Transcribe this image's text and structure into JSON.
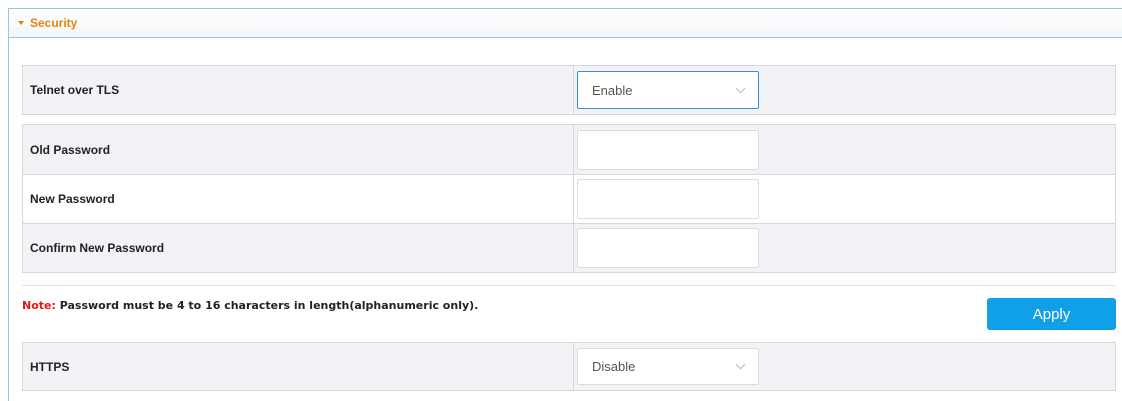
{
  "section": {
    "title": "Security"
  },
  "telnet": {
    "label": "Telnet over TLS",
    "value": "Enable"
  },
  "password": {
    "old_label": "Old Password",
    "new_label": "New Password",
    "confirm_label": "Confirm New Password",
    "old_value": "",
    "new_value": "",
    "confirm_value": ""
  },
  "note": {
    "label": "Note:",
    "text": " Password must be 4 to 16 characters in length(alphanumeric only)."
  },
  "apply": {
    "label": "Apply"
  },
  "https": {
    "label": "HTTPS",
    "value": "Disable"
  },
  "colors": {
    "accent_orange": "#e8820c",
    "button_blue": "#0fa0e8",
    "note_red": "#e01818",
    "header_border": "#9cc3e0"
  }
}
